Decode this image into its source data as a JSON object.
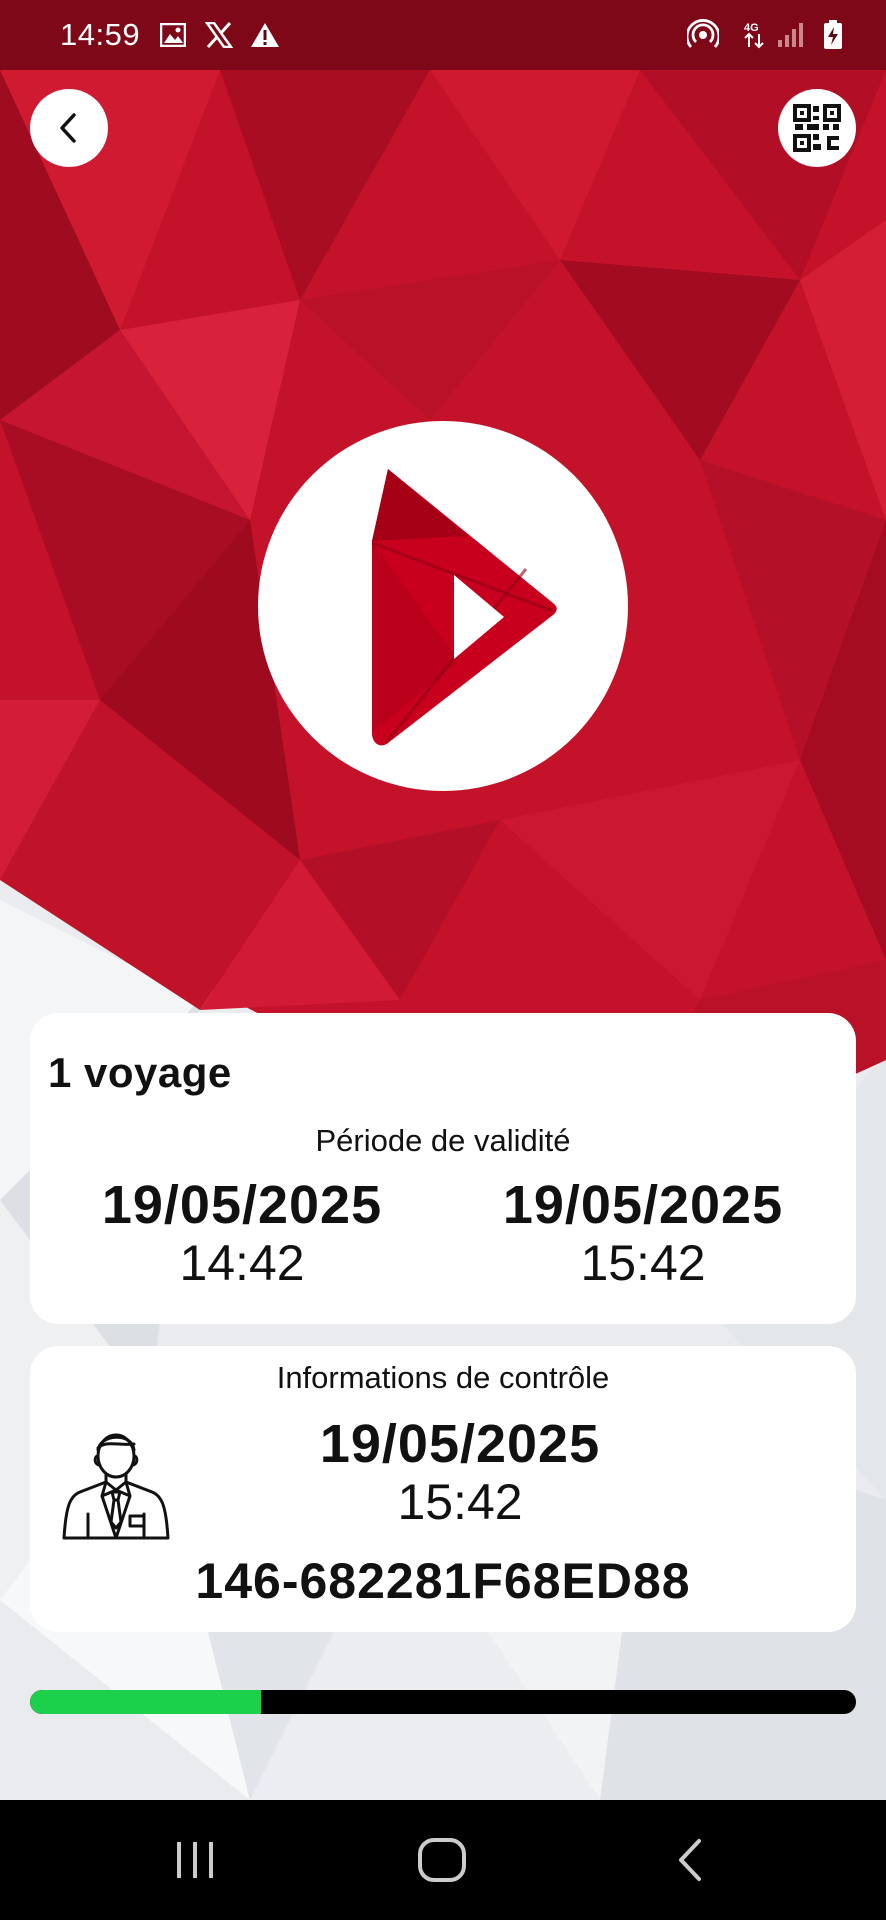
{
  "status_bar": {
    "time": "14:59",
    "icons_left": [
      "gallery-icon",
      "x-logo-icon",
      "warning-icon"
    ],
    "icons_right": [
      "hotspot-icon",
      "4g-icon",
      "signal-icon",
      "battery-charging-icon"
    ],
    "network": "4G"
  },
  "header": {
    "back_icon": "chevron-left-icon",
    "qr_icon": "qr-code-icon"
  },
  "brand": {
    "logo_icon": "play-logo-icon",
    "primary_color": "#c8001e"
  },
  "ticket": {
    "title": "1 voyage",
    "validity_label": "Période de validité",
    "start_date": "19/05/2025",
    "start_time": "14:42",
    "end_date": "19/05/2025",
    "end_time": "15:42"
  },
  "control": {
    "label": "Informations de contrôle",
    "agent_icon": "ticket-inspector-icon",
    "date": "19/05/2025",
    "time": "15:42",
    "ticket_id": "146-682281F68ED88"
  },
  "progress": {
    "fraction_elapsed": 0.28,
    "fill_color": "#1bd14b",
    "track_color": "#000000"
  },
  "nav_bar": {
    "items": [
      "recent-apps-icon",
      "home-icon",
      "back-icon"
    ]
  }
}
